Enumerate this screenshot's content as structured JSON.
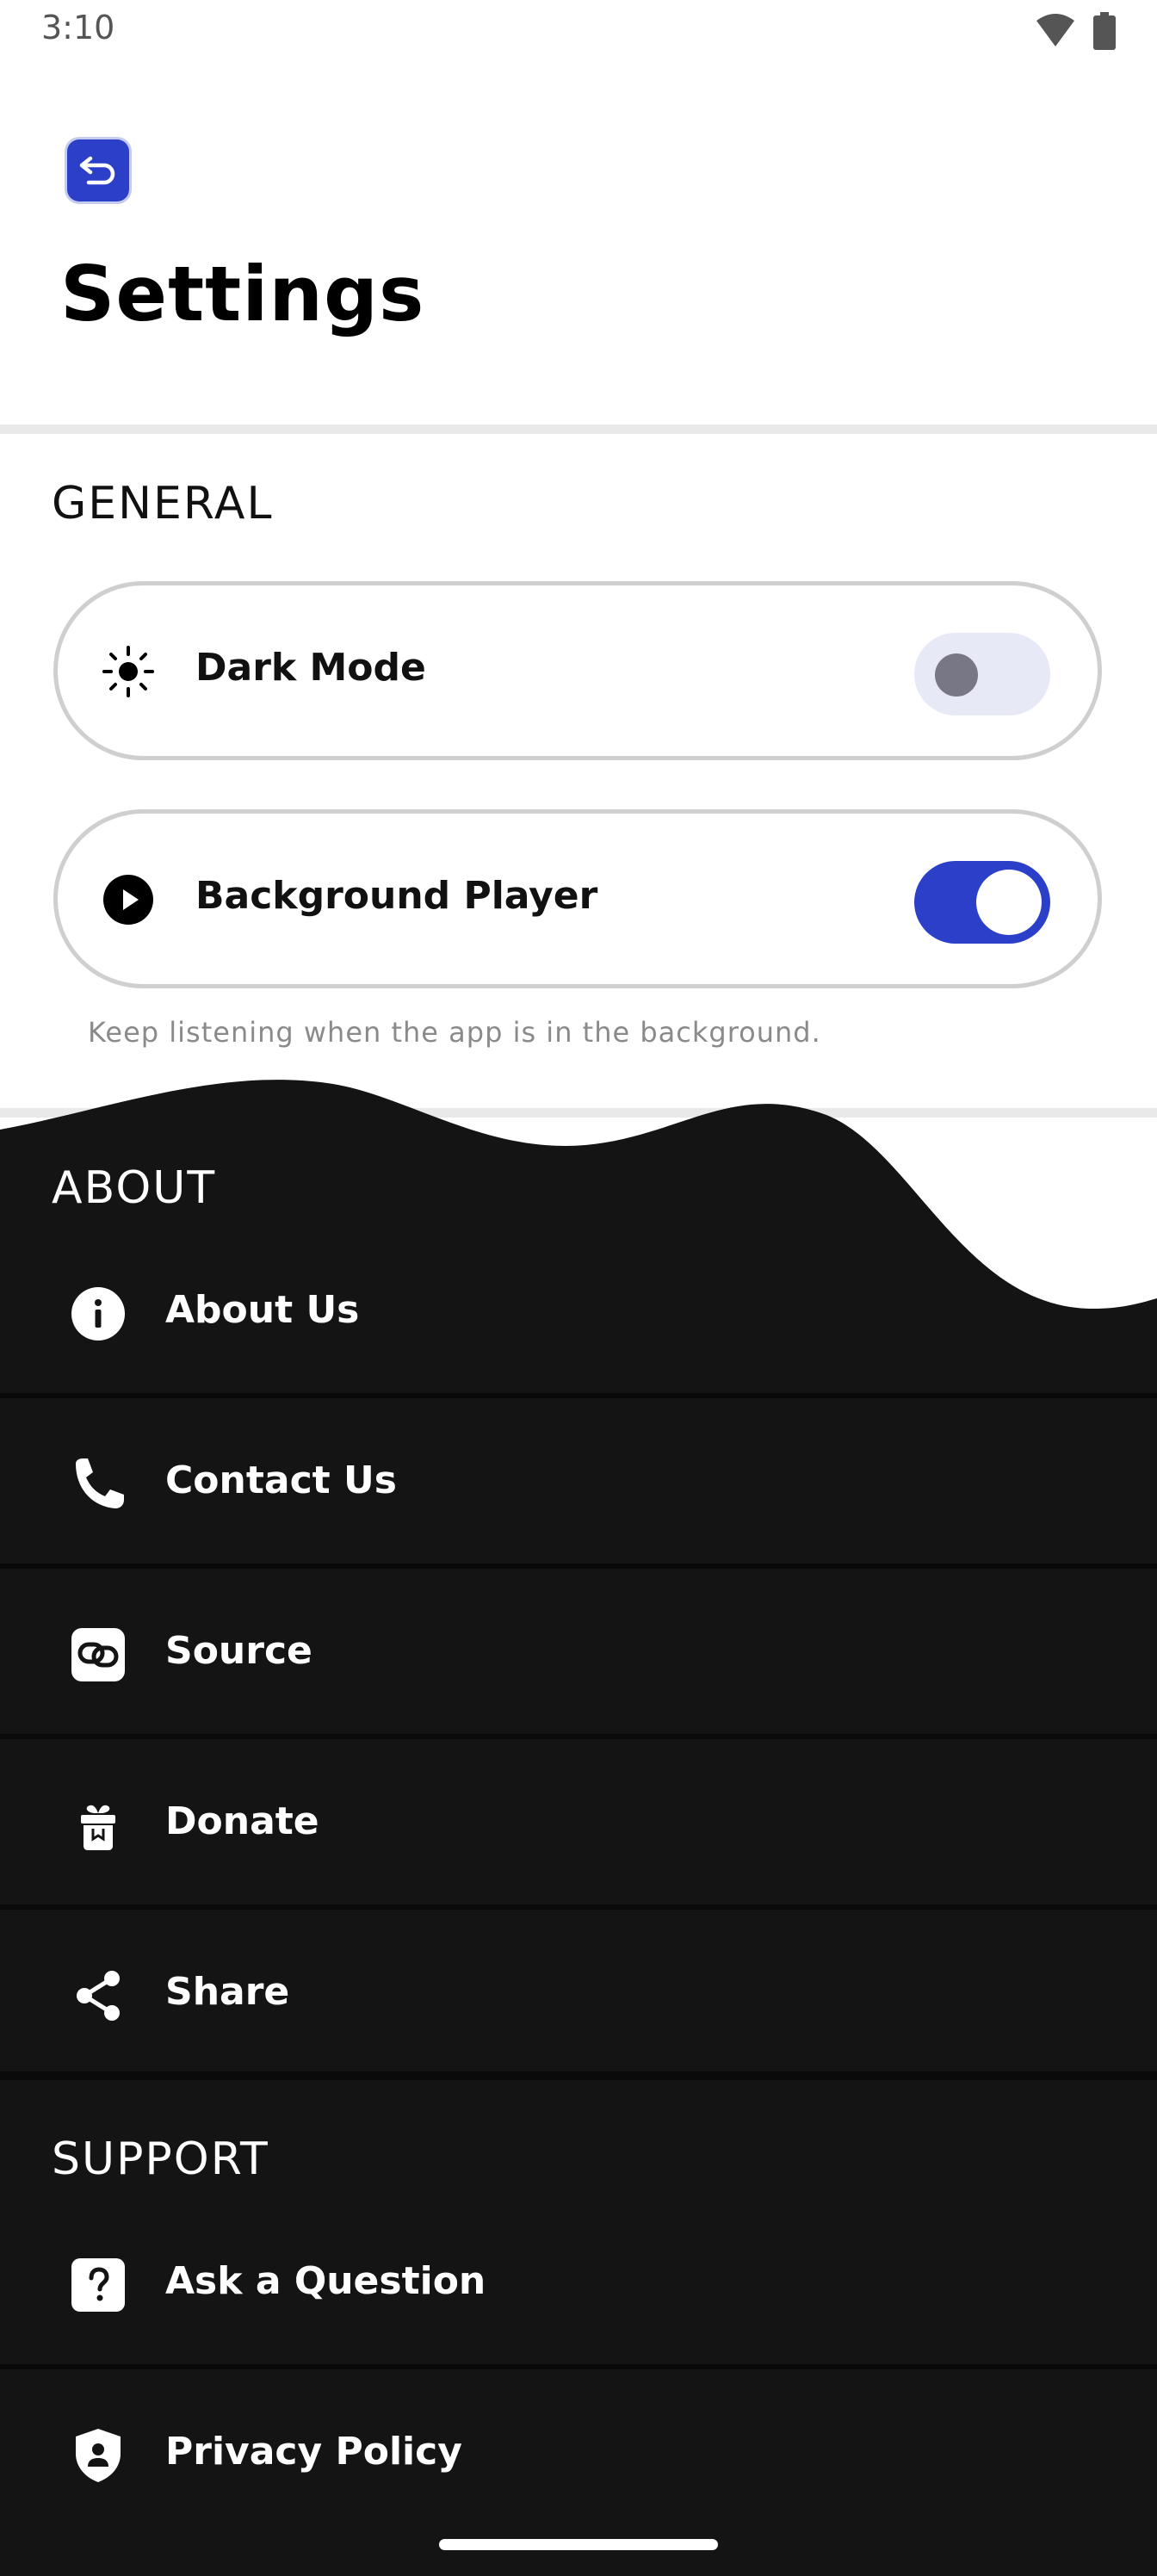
{
  "status_bar": {
    "time": "3:10"
  },
  "header": {
    "title": "Settings",
    "back_icon": "back-arrow-icon"
  },
  "general": {
    "section_title": "GENERAL",
    "dark_mode": {
      "label": "Dark Mode",
      "icon": "sun-icon",
      "enabled": false
    },
    "background_player": {
      "label": "Background Player",
      "icon": "play-icon",
      "enabled": true,
      "helper": "Keep listening when the app is in the background."
    }
  },
  "about": {
    "section_title": "ABOUT",
    "items": [
      {
        "label": "About Us",
        "icon": "info-icon"
      },
      {
        "label": "Contact Us",
        "icon": "phone-icon"
      },
      {
        "label": "Source",
        "icon": "link-icon"
      },
      {
        "label": "Donate",
        "icon": "gift-icon"
      },
      {
        "label": "Share",
        "icon": "share-icon"
      }
    ]
  },
  "support": {
    "section_title": "SUPPORT",
    "items": [
      {
        "label": "Ask a Question",
        "icon": "question-icon"
      },
      {
        "label": "Privacy Policy",
        "icon": "shield-icon"
      }
    ]
  },
  "colors": {
    "accent": "#2b3fc9",
    "dark_bg": "#141414"
  }
}
